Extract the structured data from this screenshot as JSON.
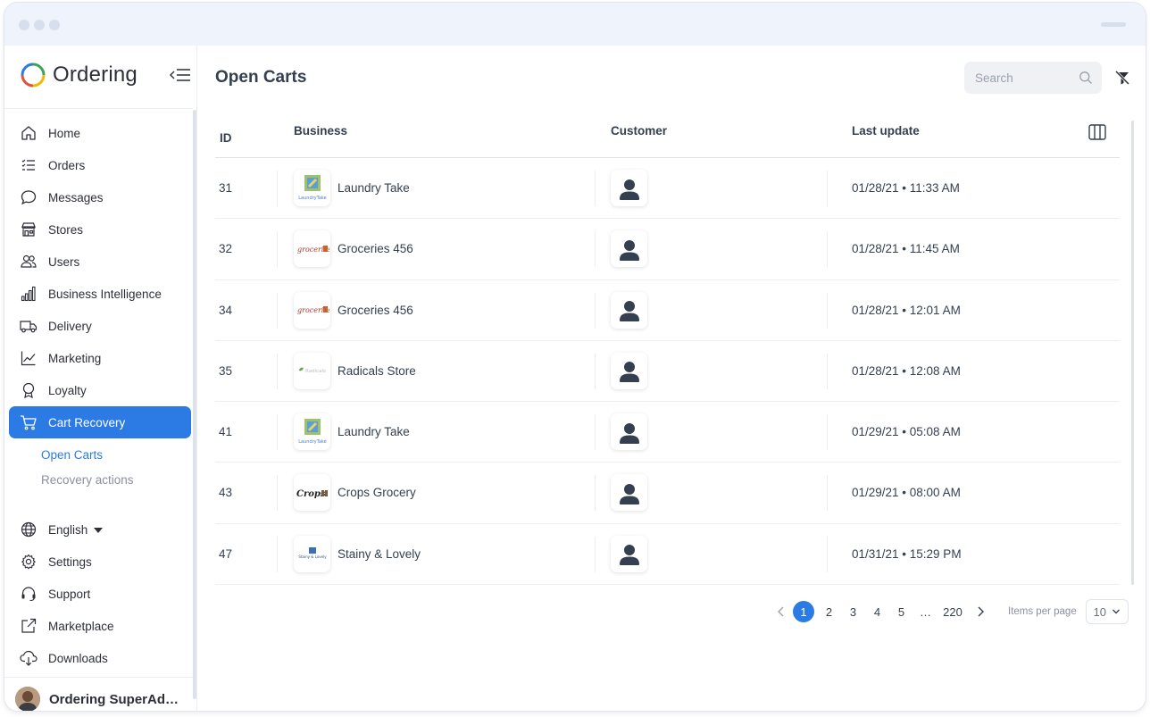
{
  "sidebar": {
    "brand": "Ordering",
    "items": [
      {
        "label": "Home",
        "icon": "home-icon"
      },
      {
        "label": "Orders",
        "icon": "list-icon"
      },
      {
        "label": "Messages",
        "icon": "chat-icon"
      },
      {
        "label": "Stores",
        "icon": "shop-icon"
      },
      {
        "label": "Users",
        "icon": "people-icon"
      },
      {
        "label": "Business Intelligence",
        "icon": "bar-chart-icon"
      },
      {
        "label": "Delivery",
        "icon": "truck-icon"
      },
      {
        "label": "Marketing",
        "icon": "graph-icon"
      },
      {
        "label": "Loyalty",
        "icon": "award-icon"
      },
      {
        "label": "Cart Recovery",
        "icon": "cart-icon"
      }
    ],
    "subitems": [
      "Open Carts",
      "Recovery actions"
    ],
    "bottom": {
      "language": "English",
      "settings": "Settings",
      "support": "Support",
      "marketplace": "Marketplace",
      "downloads": "Downloads"
    },
    "user": "Ordering SuperAd…"
  },
  "header": {
    "title": "Open Carts",
    "search_placeholder": "Search"
  },
  "table": {
    "columns": {
      "id": "ID",
      "business": "Business",
      "customer": "Customer",
      "last_update": "Last update"
    },
    "rows": [
      {
        "id": "31",
        "business": "Laundry Take",
        "logo": "laundry",
        "date": "01/28/21 • 11:33 AM"
      },
      {
        "id": "32",
        "business": "Groceries 456",
        "logo": "groceries",
        "date": "01/28/21 • 11:45 AM"
      },
      {
        "id": "34",
        "business": "Groceries 456",
        "logo": "groceries",
        "date": "01/28/21 • 12:01 AM"
      },
      {
        "id": "35",
        "business": "Radicals Store",
        "logo": "radicals",
        "date": "01/28/21 • 12:08 AM"
      },
      {
        "id": "41",
        "business": "Laundry Take",
        "logo": "laundry",
        "date": "01/29/21 • 05:08 AM"
      },
      {
        "id": "43",
        "business": "Crops Grocery",
        "logo": "crops",
        "date": "01/29/21 • 08:00 AM"
      },
      {
        "id": "47",
        "business": "Stainy & Lovely",
        "logo": "stainy",
        "date": "01/31/21 • 15:29 PM"
      }
    ]
  },
  "logos": {
    "laundry_text": "LaundryTake",
    "groceries_text": "groceries",
    "radicals_text": "Radicals",
    "crops_text": "Crops",
    "stainy_text": "Stainy & Lovely"
  },
  "pagination": {
    "pages": [
      "1",
      "2",
      "3",
      "4",
      "5",
      "…",
      "220"
    ],
    "current": "1",
    "items_per_page_label": "Items per page",
    "items_per_page": "10"
  },
  "colors": {
    "accent": "#2c7be5",
    "text": "#344050",
    "muted": "#8b90a0"
  }
}
